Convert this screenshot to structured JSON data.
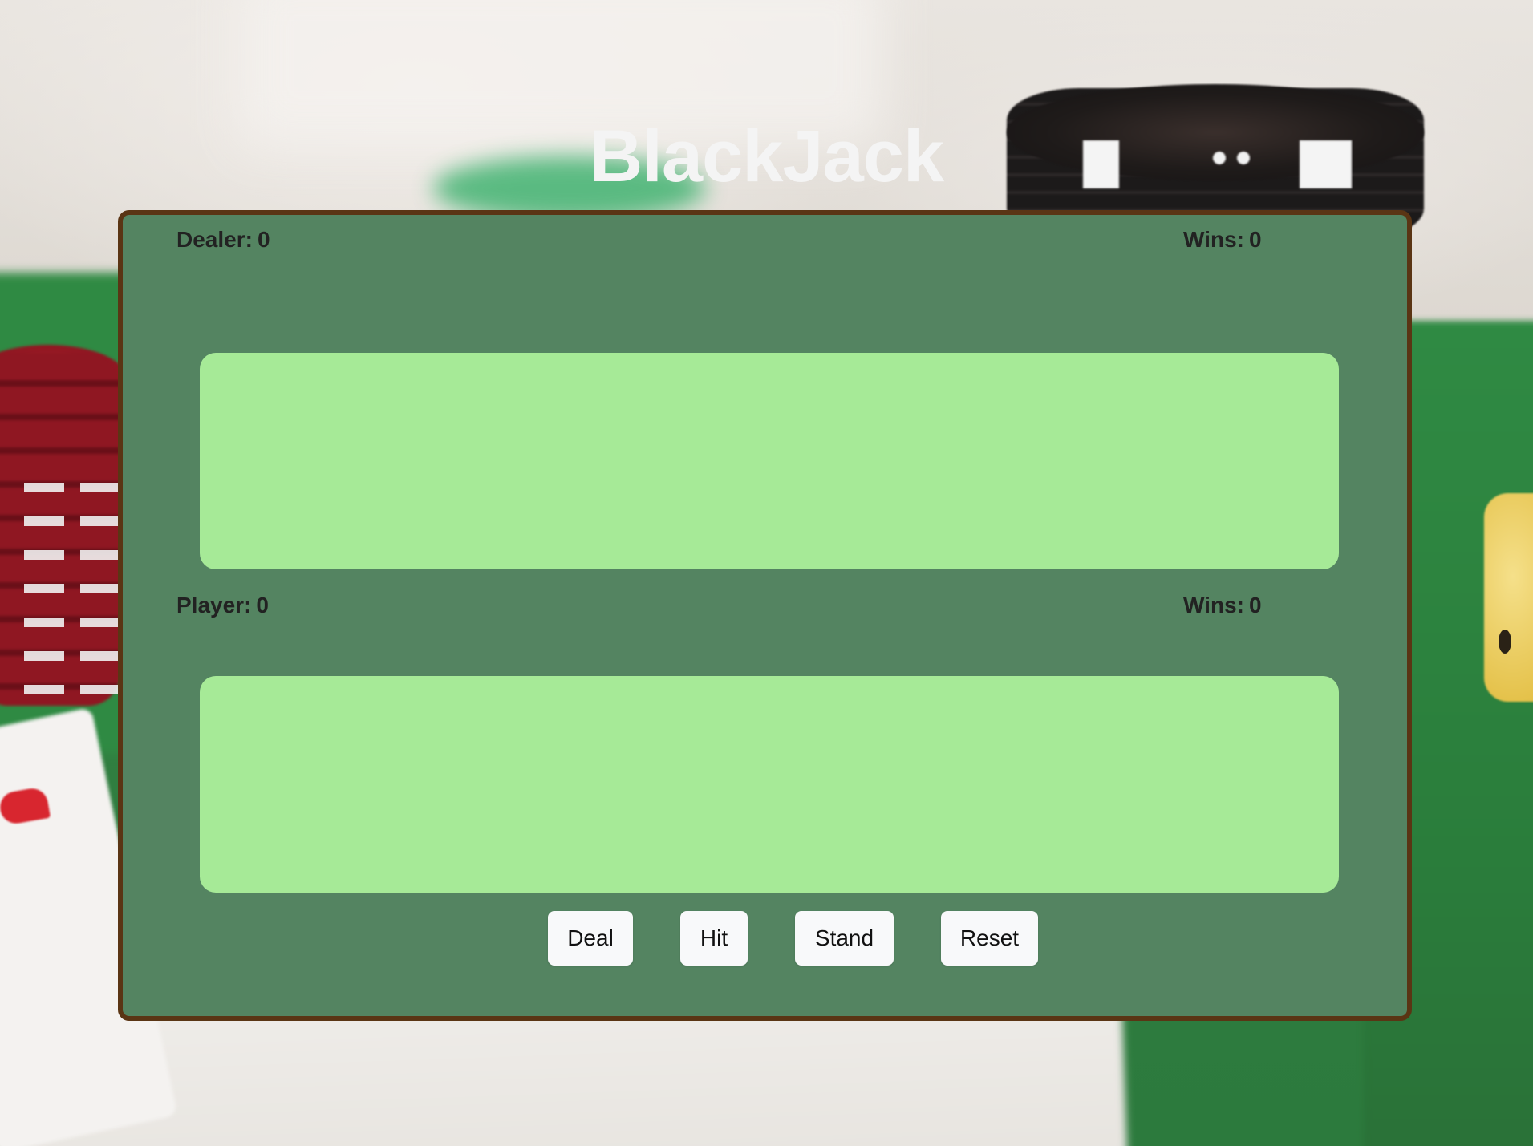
{
  "app": {
    "title": "BlackJack"
  },
  "dealer": {
    "label": "Dealer:",
    "score": "0",
    "wins_label": "Wins:",
    "wins": "0"
  },
  "player": {
    "label": "Player:",
    "score": "0",
    "wins_label": "Wins:",
    "wins": "0"
  },
  "controls": {
    "deal_label": "Deal",
    "hit_label": "Hit",
    "stand_label": "Stand",
    "reset_label": "Reset"
  },
  "colors": {
    "table_felt": "#548461",
    "table_border": "#5a3514",
    "hand_area": "#a6ea97",
    "button_bg": "#f8f9fa",
    "title_text": "#f4f4f4",
    "label_text": "#222222"
  }
}
